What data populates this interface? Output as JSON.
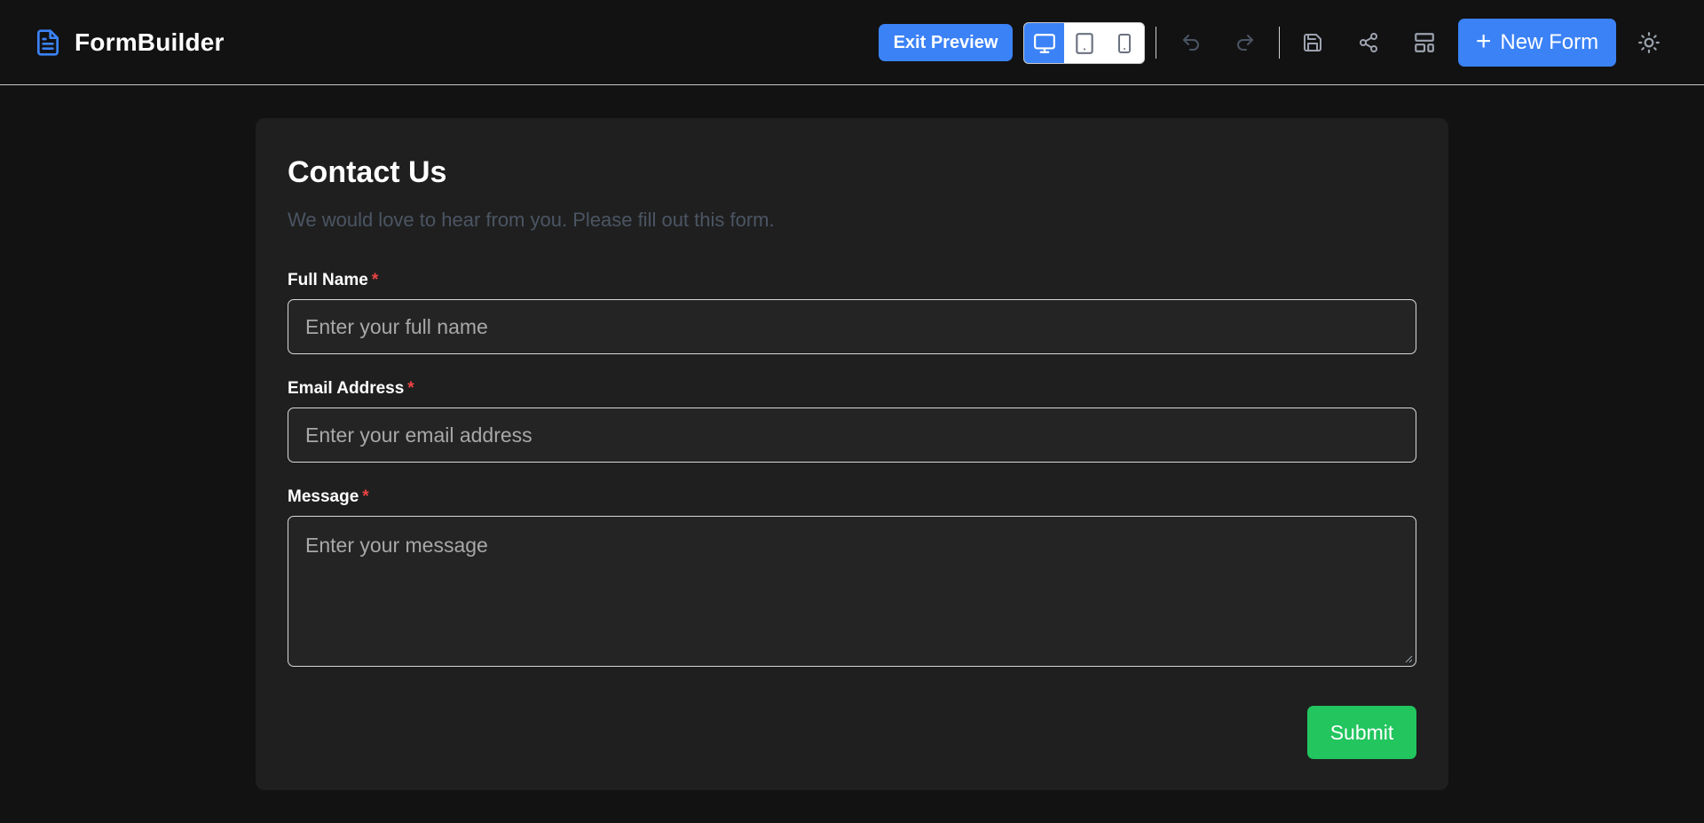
{
  "app": {
    "name": "FormBuilder"
  },
  "toolbar": {
    "exit_preview_label": "Exit Preview",
    "new_form_label": "New Form",
    "active_device": "desktop",
    "devices": [
      "desktop",
      "tablet",
      "mobile"
    ],
    "icons": [
      "undo-icon",
      "redo-icon",
      "save-icon",
      "share-icon",
      "layout-icon",
      "sun-icon"
    ]
  },
  "form": {
    "title": "Contact Us",
    "description": "We would love to hear from you. Please fill out this form.",
    "required_marker": "*",
    "fields": [
      {
        "label": "Full Name",
        "placeholder": "Enter your full name",
        "required": true,
        "type": "text"
      },
      {
        "label": "Email Address",
        "placeholder": "Enter your email address",
        "required": true,
        "type": "email"
      },
      {
        "label": "Message",
        "placeholder": "Enter your message",
        "required": true,
        "type": "textarea"
      }
    ],
    "submit_label": "Submit"
  },
  "colors": {
    "accent": "#3b82f6",
    "submit": "#22c55e",
    "required": "#ef4444",
    "background": "#121212",
    "card": "#1f1f1f"
  }
}
